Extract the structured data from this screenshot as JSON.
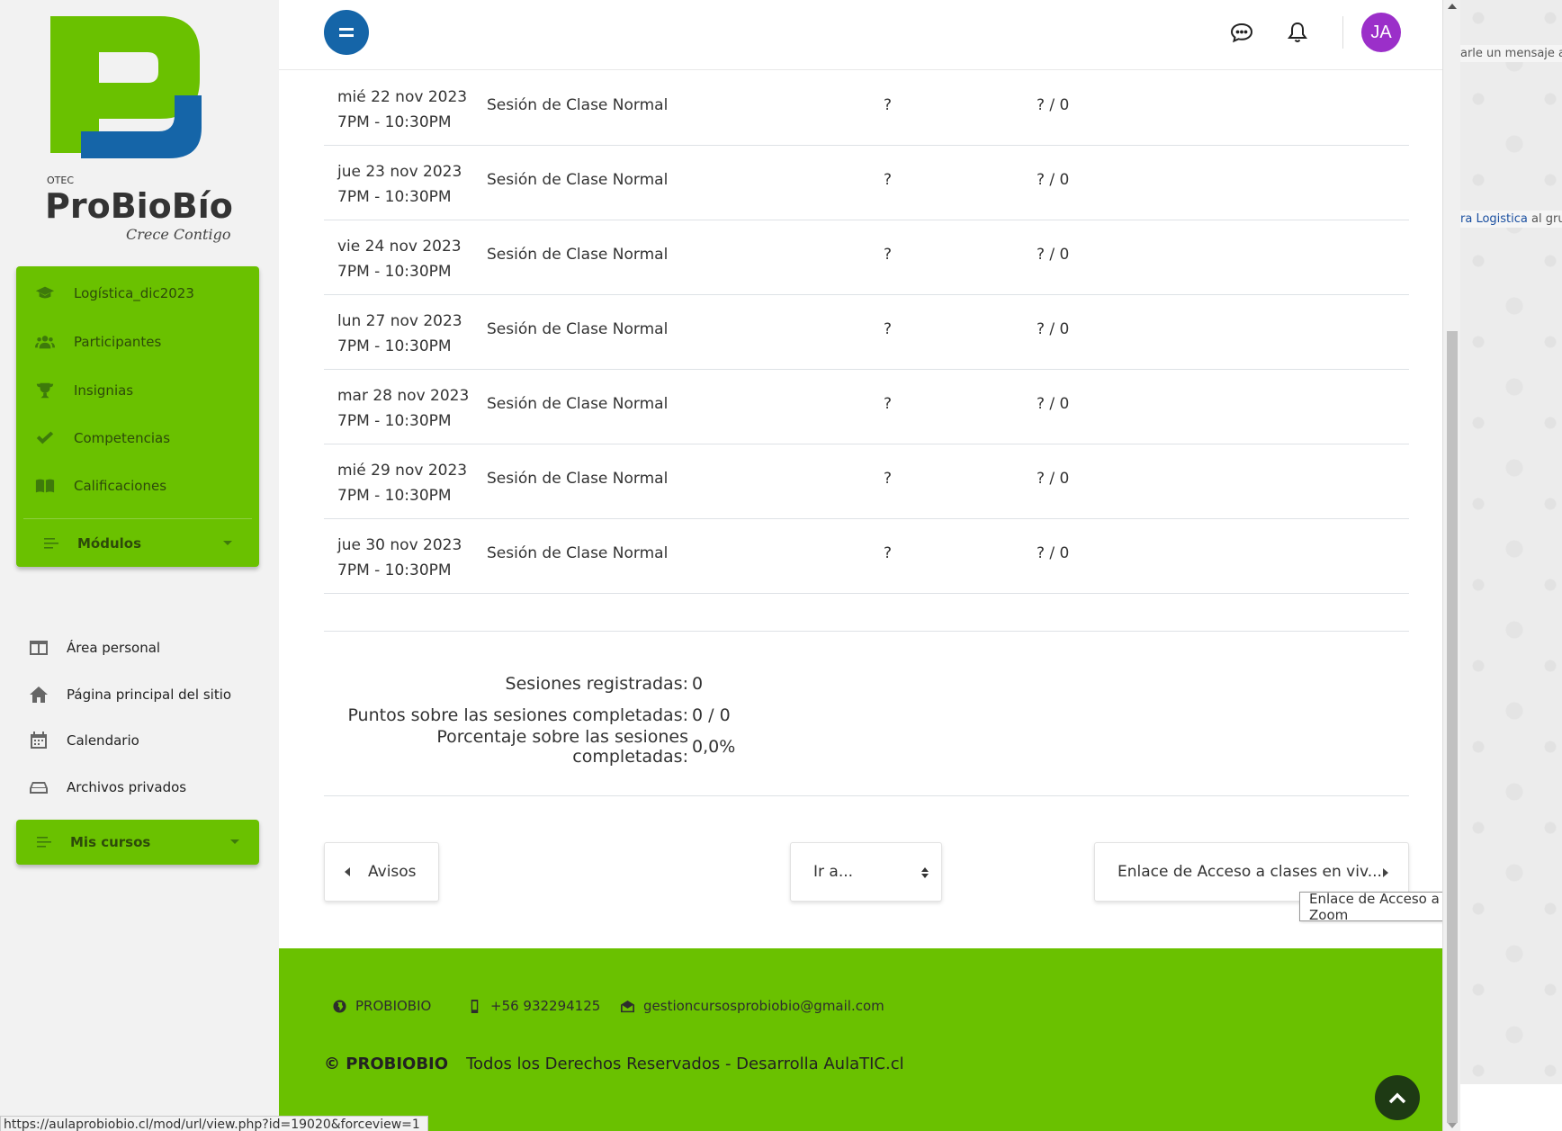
{
  "logo": {
    "otec": "OTEC",
    "name": "ProBioBío",
    "tagline": "Crece Contigo"
  },
  "course_nav": [
    {
      "label": "Logística_dic2023",
      "icon": "graduation-cap-icon"
    },
    {
      "label": "Participantes",
      "icon": "users-icon"
    },
    {
      "label": "Insignias",
      "icon": "trophy-icon"
    },
    {
      "label": "Competencias",
      "icon": "check-icon"
    },
    {
      "label": "Calificaciones",
      "icon": "book-icon"
    }
  ],
  "modules_label": "Módulos",
  "site_nav": [
    {
      "label": "Área personal",
      "icon": "dashboard-icon"
    },
    {
      "label": "Página principal del sitio",
      "icon": "home-icon"
    },
    {
      "label": "Calendario",
      "icon": "calendar-icon"
    },
    {
      "label": "Archivos privados",
      "icon": "drive-icon"
    }
  ],
  "my_courses_label": "Mis cursos",
  "topbar": {
    "avatar_initials": "JA",
    "avatar_color": "#9b2fc9"
  },
  "sessions": [
    {
      "date": "mié 22 nov 2023",
      "time": "7PM - 10:30PM",
      "description": "Sesión de Clase Normal",
      "status": "?",
      "points": "? / 0"
    },
    {
      "date": "jue 23 nov 2023",
      "time": "7PM - 10:30PM",
      "description": "Sesión de Clase Normal",
      "status": "?",
      "points": "? / 0"
    },
    {
      "date": "vie 24 nov 2023",
      "time": "7PM - 10:30PM",
      "description": "Sesión de Clase Normal",
      "status": "?",
      "points": "? / 0"
    },
    {
      "date": "lun 27 nov 2023",
      "time": "7PM - 10:30PM",
      "description": "Sesión de Clase Normal",
      "status": "?",
      "points": "? / 0"
    },
    {
      "date": "mar 28 nov 2023",
      "time": "7PM - 10:30PM",
      "description": "Sesión de Clase Normal",
      "status": "?",
      "points": "? / 0"
    },
    {
      "date": "mié 29 nov 2023",
      "time": "7PM - 10:30PM",
      "description": "Sesión de Clase Normal",
      "status": "?",
      "points": "? / 0"
    },
    {
      "date": "jue 30 nov 2023",
      "time": "7PM - 10:30PM",
      "description": "Sesión de Clase Normal",
      "status": "?",
      "points": "? / 0"
    }
  ],
  "summary": [
    {
      "label": "Sesiones registradas:",
      "value": "0"
    },
    {
      "label": "Puntos sobre las sesiones completadas:",
      "value": "0 / 0"
    },
    {
      "label": "Porcentaje sobre las sesiones completadas:",
      "value": "0,0%"
    }
  ],
  "activity_nav": {
    "prev_label": "Avisos",
    "jump_label": "Ir a...",
    "next_label": "Enlace de Acceso a clases en viv...",
    "next_tooltip": "Enlace de Acceso a clases en vivo Zoom"
  },
  "footer": {
    "site": "PROBIOBIO",
    "phone": "+56 932294125",
    "email": "gestioncursosprobiobio@gmail.com",
    "copyright_brand": "© PROBIOBIO",
    "copyright_text": "Todos los Derechos Reservados - Desarrolla AulaTIC.cl"
  },
  "background_window": {
    "msg1": "arle un mensaje al r",
    "msg2_link": "ra Logistica",
    "msg2_rest": " al grup"
  },
  "status_url": "https://aulaprobiobio.cl/mod/url/view.php?id=19020&forceview=1",
  "colors": {
    "brand_green": "#6ac100",
    "brand_blue": "#1565a8",
    "to_top_bg": "#1e3a14"
  }
}
